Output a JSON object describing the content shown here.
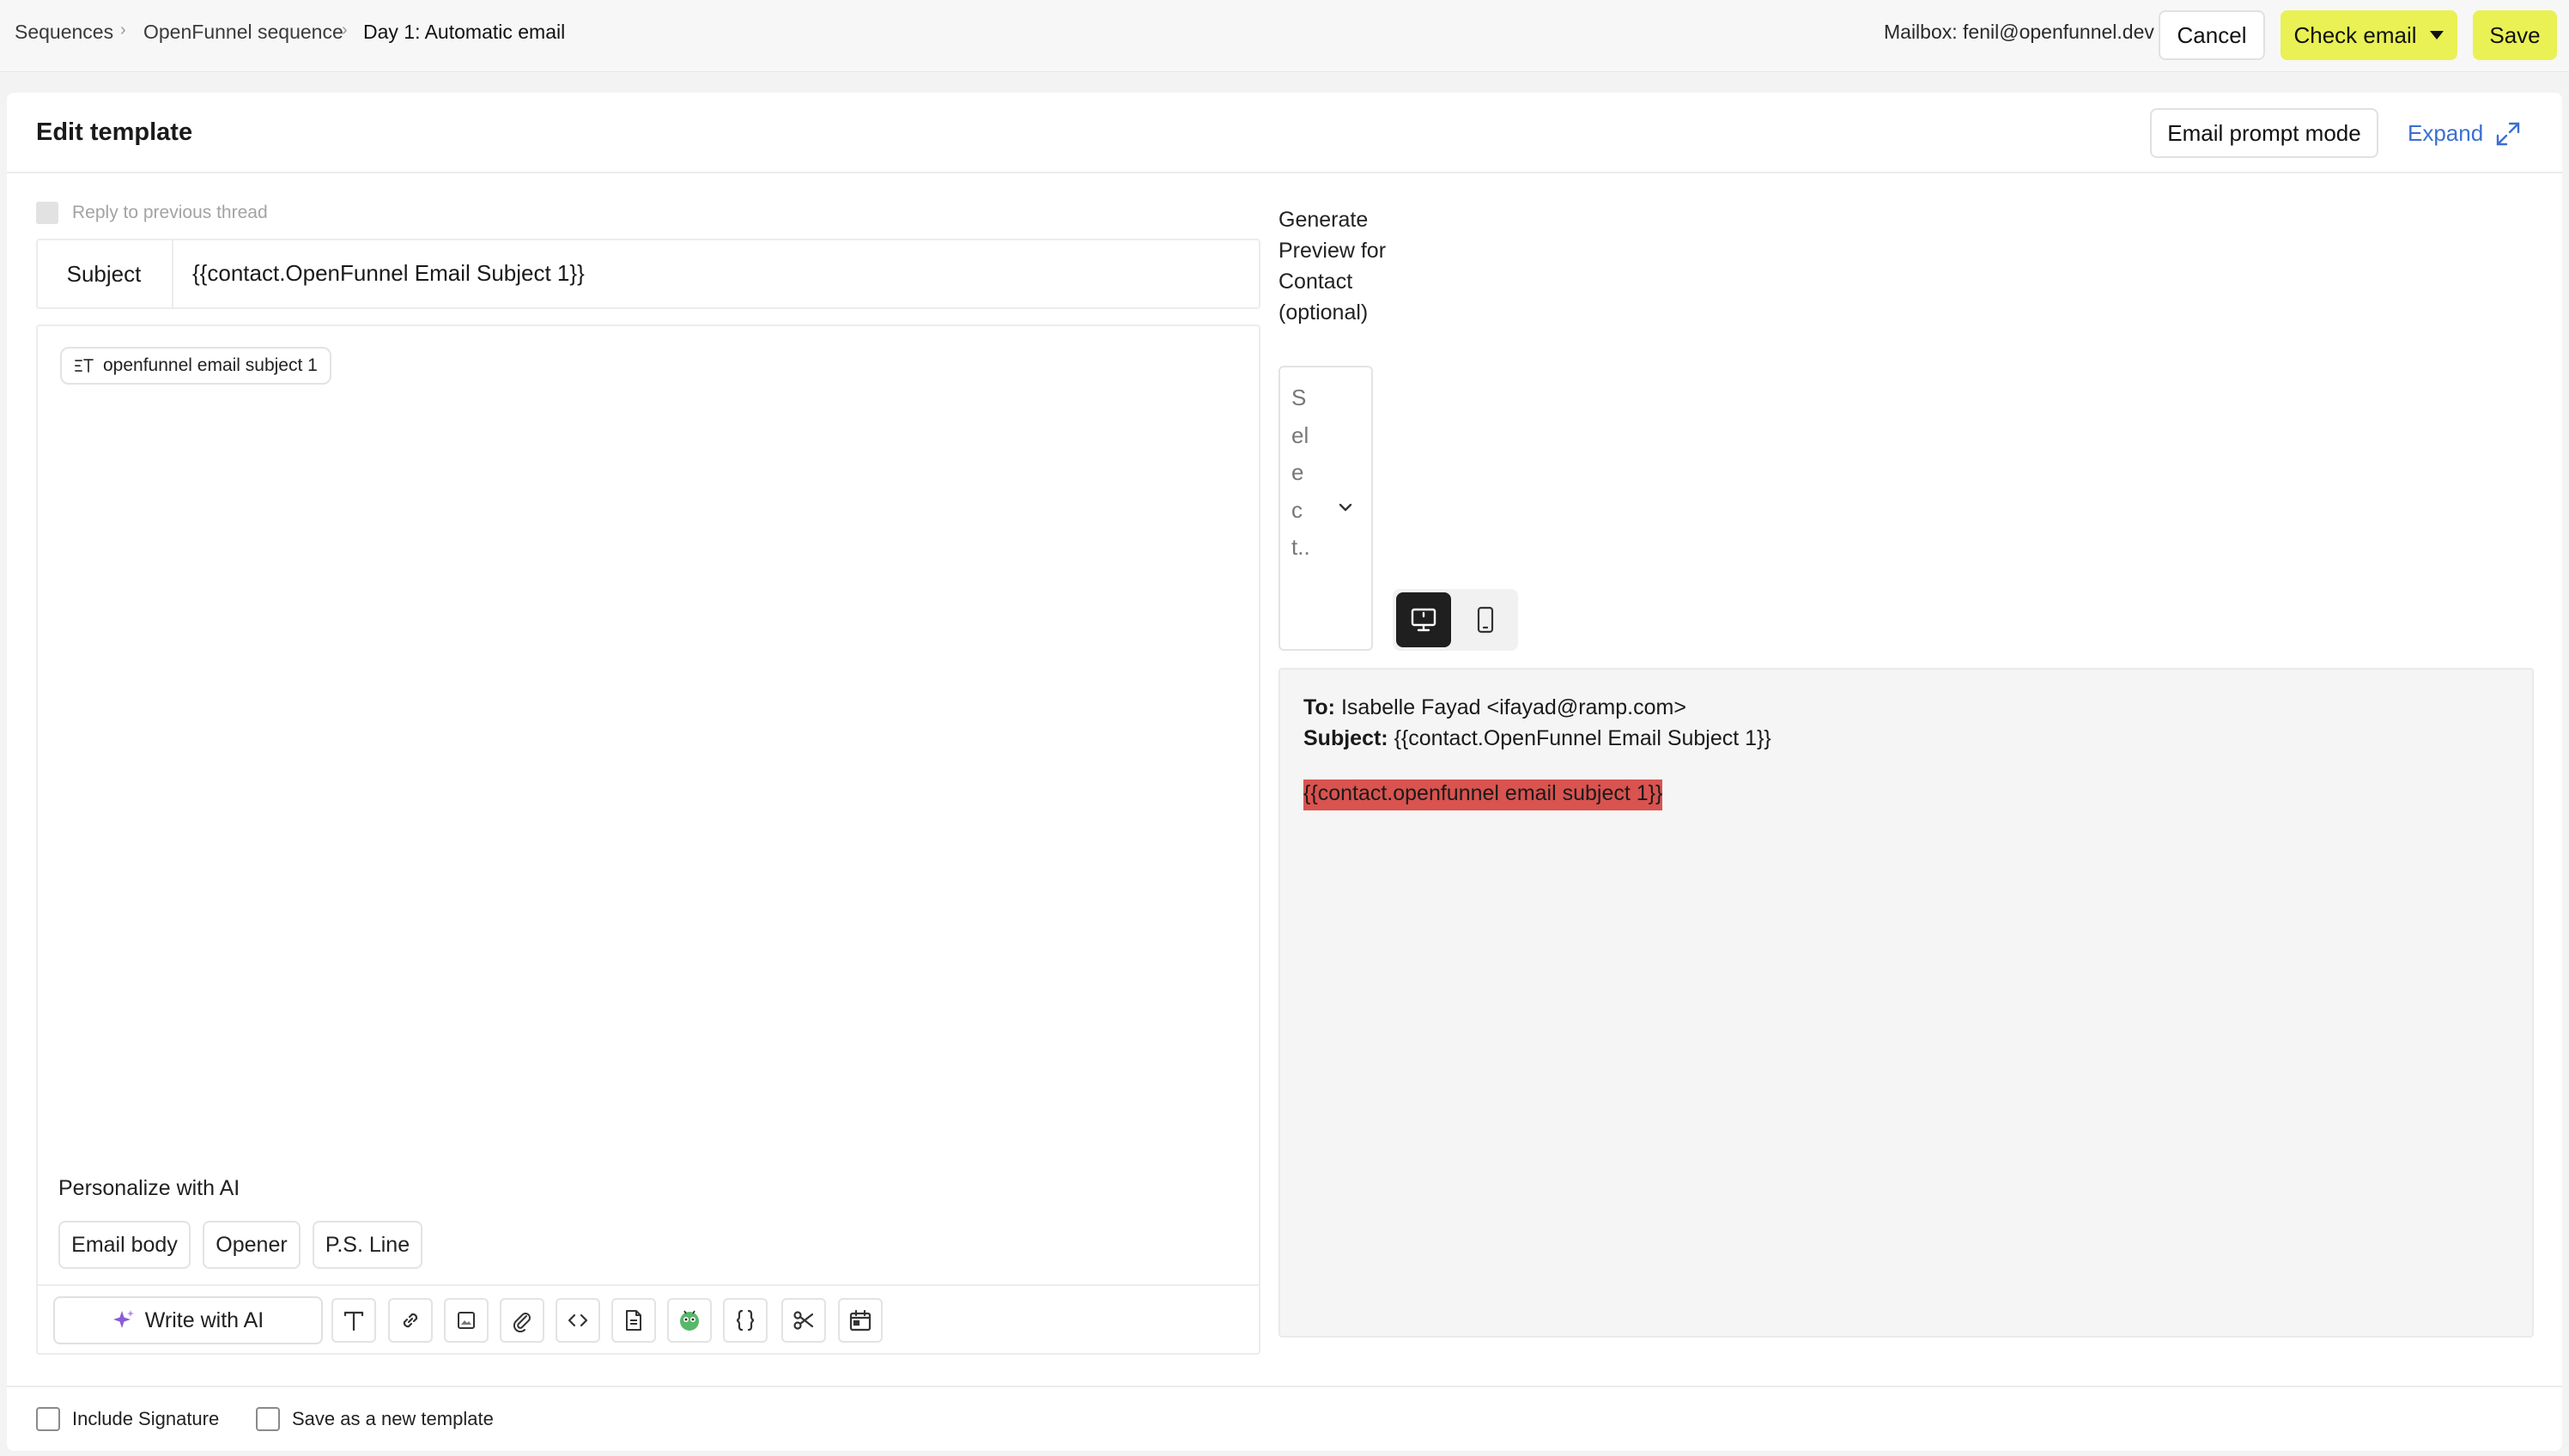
{
  "breadcrumb": {
    "items": [
      "Sequences",
      "OpenFunnel sequence",
      "Day 1: Automatic email"
    ]
  },
  "header": {
    "mailbox": "Mailbox: fenil@openfunnel.dev",
    "cancel_label": "Cancel",
    "check_email_label": "Check email",
    "save_label": "Save",
    "accent_color": "#e9f154"
  },
  "editor": {
    "title": "Edit template",
    "email_prompt_mode_label": "Email prompt mode",
    "expand_label": "Expand",
    "reply_label": "Reply to previous thread",
    "subject_label": "Subject",
    "subject_value": "{{contact.OpenFunnel Email Subject 1}}",
    "variable_chip": "openfunnel email subject 1",
    "personalize_label": "Personalize with AI",
    "personalize_options": [
      "Email body",
      "Opener",
      "P.S. Line"
    ],
    "write_ai_label": "Write with AI",
    "toolbar_icons": [
      "text-format-icon",
      "link-icon",
      "image-icon",
      "attachment-icon",
      "code-icon",
      "document-icon",
      "bug-icon",
      "braces-icon",
      "scissors-icon",
      "calendar-icon"
    ]
  },
  "preview": {
    "generate_label": "Generate Preview for Contact (optional)",
    "select_placeholder": "Select..",
    "to_label": "To:",
    "to_value": "Isabelle Fayad <ifayad@ramp.com>",
    "subject_label": "Subject:",
    "subject_value": "{{contact.OpenFunnel Email Subject 1}}",
    "body_token": "{{contact.openfunnel email subject 1}}",
    "token_color": "#d9534f"
  },
  "footer": {
    "include_signature": "Include Signature",
    "save_as_template": "Save as a new template"
  }
}
